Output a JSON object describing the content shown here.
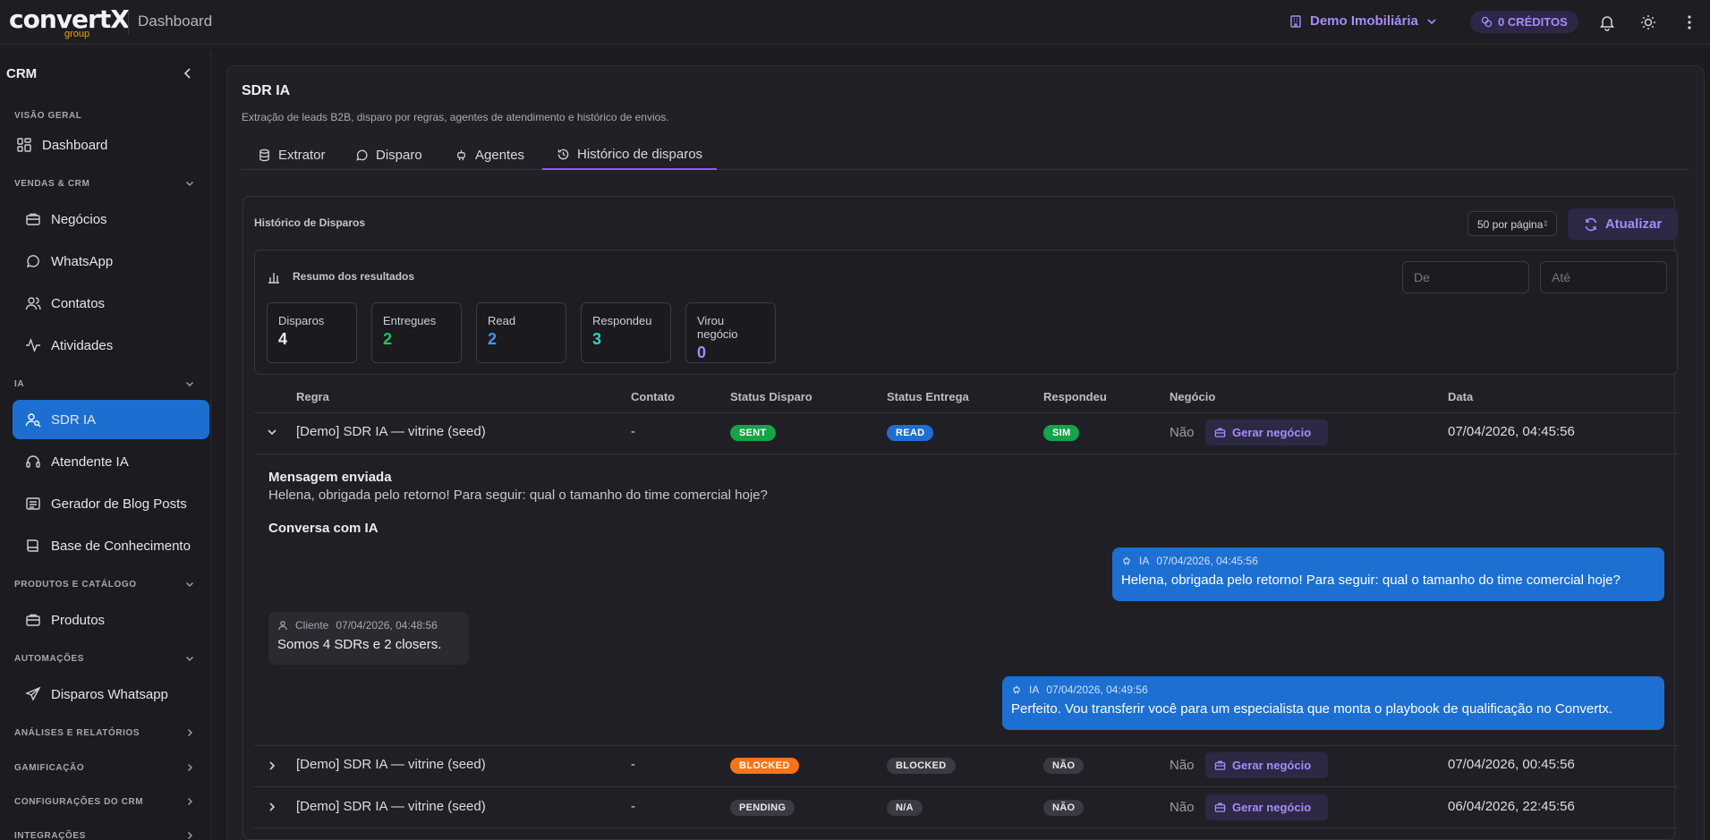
{
  "header": {
    "logo_text": "convertX",
    "logo_sub": "group",
    "title": "Dashboard",
    "org": "Demo Imobiliária",
    "credits": "0 CRÉDITOS"
  },
  "sidebar": {
    "title": "CRM",
    "sections": [
      {
        "label": "VISÃO GERAL"
      },
      {
        "label": "VENDAS & CRM"
      },
      {
        "label": "IA"
      },
      {
        "label": "PRODUTOS E CATÁLOGO"
      },
      {
        "label": "AUTOMAÇÕES"
      },
      {
        "label": "ANÁLISES E RELATÓRIOS"
      },
      {
        "label": "GAMIFICAÇÃO"
      },
      {
        "label": "CONFIGURAÇÕES DO CRM"
      },
      {
        "label": "INTEGRAÇÕES"
      }
    ],
    "items": [
      {
        "label": "Dashboard"
      },
      {
        "label": "Negócios"
      },
      {
        "label": "WhatsApp"
      },
      {
        "label": "Contatos"
      },
      {
        "label": "Atividades"
      },
      {
        "label": "SDR IA"
      },
      {
        "label": "Atendente IA"
      },
      {
        "label": "Gerador de Blog Posts"
      },
      {
        "label": "Base de Conhecimento"
      },
      {
        "label": "Produtos"
      },
      {
        "label": "Disparos Whatsapp"
      }
    ]
  },
  "page": {
    "title": "SDR IA",
    "subtitle": "Extração de leads B2B, disparo por regras, agentes de atendimento e histórico de envios.",
    "tabs": [
      {
        "label": "Extrator"
      },
      {
        "label": "Disparo"
      },
      {
        "label": "Agentes"
      },
      {
        "label": "Histórico de disparos"
      }
    ]
  },
  "history": {
    "title": "Histórico de Disparos",
    "per_page": "50 por página",
    "refresh_label": "Atualizar",
    "summary_title": "Resumo dos resultados",
    "date_from_placeholder": "De",
    "date_to_placeholder": "Até",
    "stats": [
      {
        "label": "Disparos",
        "value": "4",
        "color": "#f0f0f3"
      },
      {
        "label": "Entregues",
        "value": "2",
        "color": "#22c55e"
      },
      {
        "label": "Read",
        "value": "2",
        "color": "#3b9bf0"
      },
      {
        "label": "Respondeu",
        "value": "3",
        "color": "#2dd4bf"
      },
      {
        "label": "Virou negócio",
        "value": "0",
        "color": "#a78bfa"
      }
    ],
    "columns": [
      "Regra",
      "Contato",
      "Status Disparo",
      "Status Entrega",
      "Respondeu",
      "Negócio",
      "Data"
    ],
    "rows": [
      {
        "rule": "[Demo] SDR IA — vitrine (seed)",
        "contact": "-",
        "status_send": "SENT",
        "status_delivery": "READ",
        "replied": "SIM",
        "deal": "Não",
        "deal_button": "Gerar negócio",
        "date": "07/04/2026, 04:45:56"
      },
      {
        "rule": "[Demo] SDR IA — vitrine (seed)",
        "contact": "-",
        "status_send": "BLOCKED",
        "status_delivery": "BLOCKED",
        "replied": "NÃO",
        "deal": "Não",
        "deal_button": "Gerar negócio",
        "date": "07/04/2026, 00:45:56"
      },
      {
        "rule": "[Demo] SDR IA — vitrine (seed)",
        "contact": "-",
        "status_send": "PENDING",
        "status_delivery": "N/A",
        "replied": "NÃO",
        "deal": "Não",
        "deal_button": "Gerar negócio",
        "date": "06/04/2026, 22:45:56"
      }
    ],
    "expanded": {
      "sent_label": "Mensagem enviada",
      "sent_text": "Helena, obrigada pelo retorno! Para seguir: qual o tamanho do time comercial hoje?",
      "conversation_label": "Conversa com IA",
      "messages": [
        {
          "author": "IA",
          "time": "07/04/2026, 04:45:56",
          "text": "Helena, obrigada pelo retorno! Para seguir: qual o tamanho do time comercial hoje?"
        },
        {
          "author": "Cliente",
          "time": "07/04/2026, 04:48:56",
          "text": "Somos 4 SDRs e 2 closers."
        },
        {
          "author": "IA",
          "time": "07/04/2026, 04:49:56",
          "text": "Perfeito. Vou transferir você para um especialista que monta o playbook de qualificação no Convertx."
        }
      ]
    }
  }
}
